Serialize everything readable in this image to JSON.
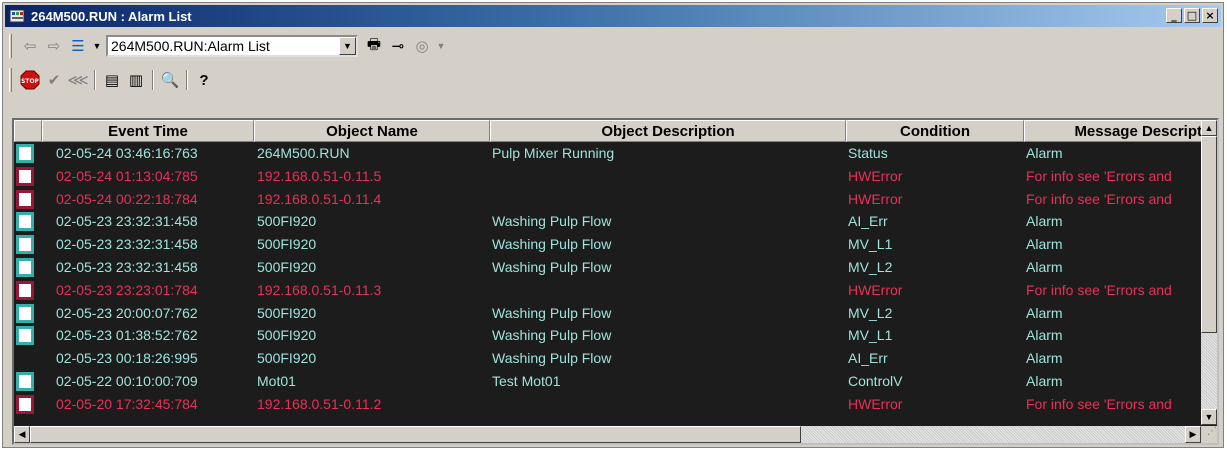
{
  "window": {
    "title": "264M500.RUN : Alarm List",
    "minimize_label": "_",
    "maximize_label": "□",
    "close_label": "×"
  },
  "toolbar": {
    "view_select": "264M500.RUN:Alarm List"
  },
  "columns": [
    "Event Time",
    "Object Name",
    "Object Description",
    "Condition",
    "Message Descript"
  ],
  "rows": [
    {
      "time": "02-05-24 03:46:16:763",
      "object": "264M500.RUN",
      "description": "Pulp Mixer Running",
      "condition": "Status",
      "message": "Alarm",
      "style": "teal",
      "checkbox": true
    },
    {
      "time": "02-05-24 01:13:04:785",
      "object": "192.168.0.51-0.11.5",
      "description": "",
      "condition": "HWError",
      "message": "For info see 'Errors and",
      "style": "red",
      "checkbox": true
    },
    {
      "time": "02-05-24 00:22:18:784",
      "object": "192.168.0.51-0.11.4",
      "description": "",
      "condition": "HWError",
      "message": "For info see 'Errors and",
      "style": "red",
      "checkbox": true
    },
    {
      "time": "02-05-23 23:32:31:458",
      "object": "500FI920",
      "description": "Washing Pulp Flow",
      "condition": "AI_Err",
      "message": "Alarm",
      "style": "teal",
      "checkbox": true
    },
    {
      "time": "02-05-23 23:32:31:458",
      "object": "500FI920",
      "description": "Washing Pulp Flow",
      "condition": "MV_L1",
      "message": "Alarm",
      "style": "teal",
      "checkbox": true
    },
    {
      "time": "02-05-23 23:32:31:458",
      "object": "500FI920",
      "description": "Washing Pulp Flow",
      "condition": "MV_L2",
      "message": "Alarm",
      "style": "teal",
      "checkbox": true
    },
    {
      "time": "02-05-23 23:23:01:784",
      "object": "192.168.0.51-0.11.3",
      "description": "",
      "condition": "HWError",
      "message": "For info see 'Errors and",
      "style": "red",
      "checkbox": true
    },
    {
      "time": "02-05-23 20:00:07:762",
      "object": "500FI920",
      "description": "Washing Pulp Flow",
      "condition": "MV_L2",
      "message": "Alarm",
      "style": "teal",
      "checkbox": true
    },
    {
      "time": "02-05-23 01:38:52:762",
      "object": "500FI920",
      "description": "Washing Pulp Flow",
      "condition": "MV_L1",
      "message": "Alarm",
      "style": "teal",
      "checkbox": true
    },
    {
      "time": "02-05-23 00:18:26:995",
      "object": "500FI920",
      "description": "Washing Pulp Flow",
      "condition": "AI_Err",
      "message": "Alarm",
      "style": "teal",
      "checkbox": false
    },
    {
      "time": "02-05-22 00:10:00:709",
      "object": "Mot01",
      "description": "Test Mot01",
      "condition": "ControlV",
      "message": "Alarm",
      "style": "teal",
      "checkbox": true
    },
    {
      "time": "02-05-20 17:32:45:784",
      "object": "192.168.0.51-0.11.2",
      "description": "",
      "condition": "HWError",
      "message": "For info see 'Errors and",
      "style": "red",
      "checkbox": true
    }
  ],
  "colors": {
    "grid_background": "#1c1c1c",
    "normal_text": "#9fe3db",
    "error_text": "#ea2f58",
    "title_bar": "#0a246a"
  }
}
